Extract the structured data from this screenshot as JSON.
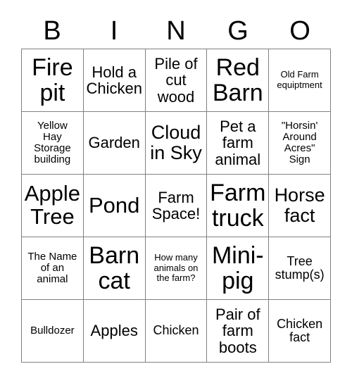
{
  "card": {
    "header": {
      "letters": [
        "B",
        "I",
        "N",
        "G",
        "O"
      ]
    },
    "rows": [
      [
        {
          "text": "Fire\npit",
          "size": "fs-xxl"
        },
        {
          "text": "Hold a\nChicken",
          "size": "fs-m"
        },
        {
          "text": "Pile of\ncut\nwood",
          "size": "fs-m"
        },
        {
          "text": "Red\nBarn",
          "size": "fs-xxl"
        },
        {
          "text": "Old Farm\nequiptment",
          "size": "fs-xxs"
        }
      ],
      [
        {
          "text": "Yellow\nHay\nStorage\nbuilding",
          "size": "fs-xs"
        },
        {
          "text": "Garden",
          "size": "fs-m"
        },
        {
          "text": "Cloud\nin Sky",
          "size": "fs-l"
        },
        {
          "text": "Pet a\nfarm\nanimal",
          "size": "fs-m"
        },
        {
          "text": "\"Horsin'\nAround\nAcres\"\nSign",
          "size": "fs-xs"
        }
      ],
      [
        {
          "text": "Apple\nTree",
          "size": "fs-xl"
        },
        {
          "text": "Pond",
          "size": "fs-xl"
        },
        {
          "text": "Farm\nSpace!",
          "size": "fs-m"
        },
        {
          "text": "Farm\ntruck",
          "size": "fs-xxl"
        },
        {
          "text": "Horse\nfact",
          "size": "fs-l"
        }
      ],
      [
        {
          "text": "The Name\nof an\nanimal",
          "size": "fs-xs"
        },
        {
          "text": "Barn\ncat",
          "size": "fs-xxl"
        },
        {
          "text": "How many\nanimals on\nthe farm?",
          "size": "fs-xxs"
        },
        {
          "text": "Mini-\npig",
          "size": "fs-xxl"
        },
        {
          "text": "Tree\nstump(s)",
          "size": "fs-s"
        }
      ],
      [
        {
          "text": "Bulldozer",
          "size": "fs-xs"
        },
        {
          "text": "Apples",
          "size": "fs-m"
        },
        {
          "text": "Chicken",
          "size": "fs-s"
        },
        {
          "text": "Pair of\nfarm\nboots",
          "size": "fs-m"
        },
        {
          "text": "Chicken\nfact",
          "size": "fs-s"
        }
      ]
    ]
  }
}
